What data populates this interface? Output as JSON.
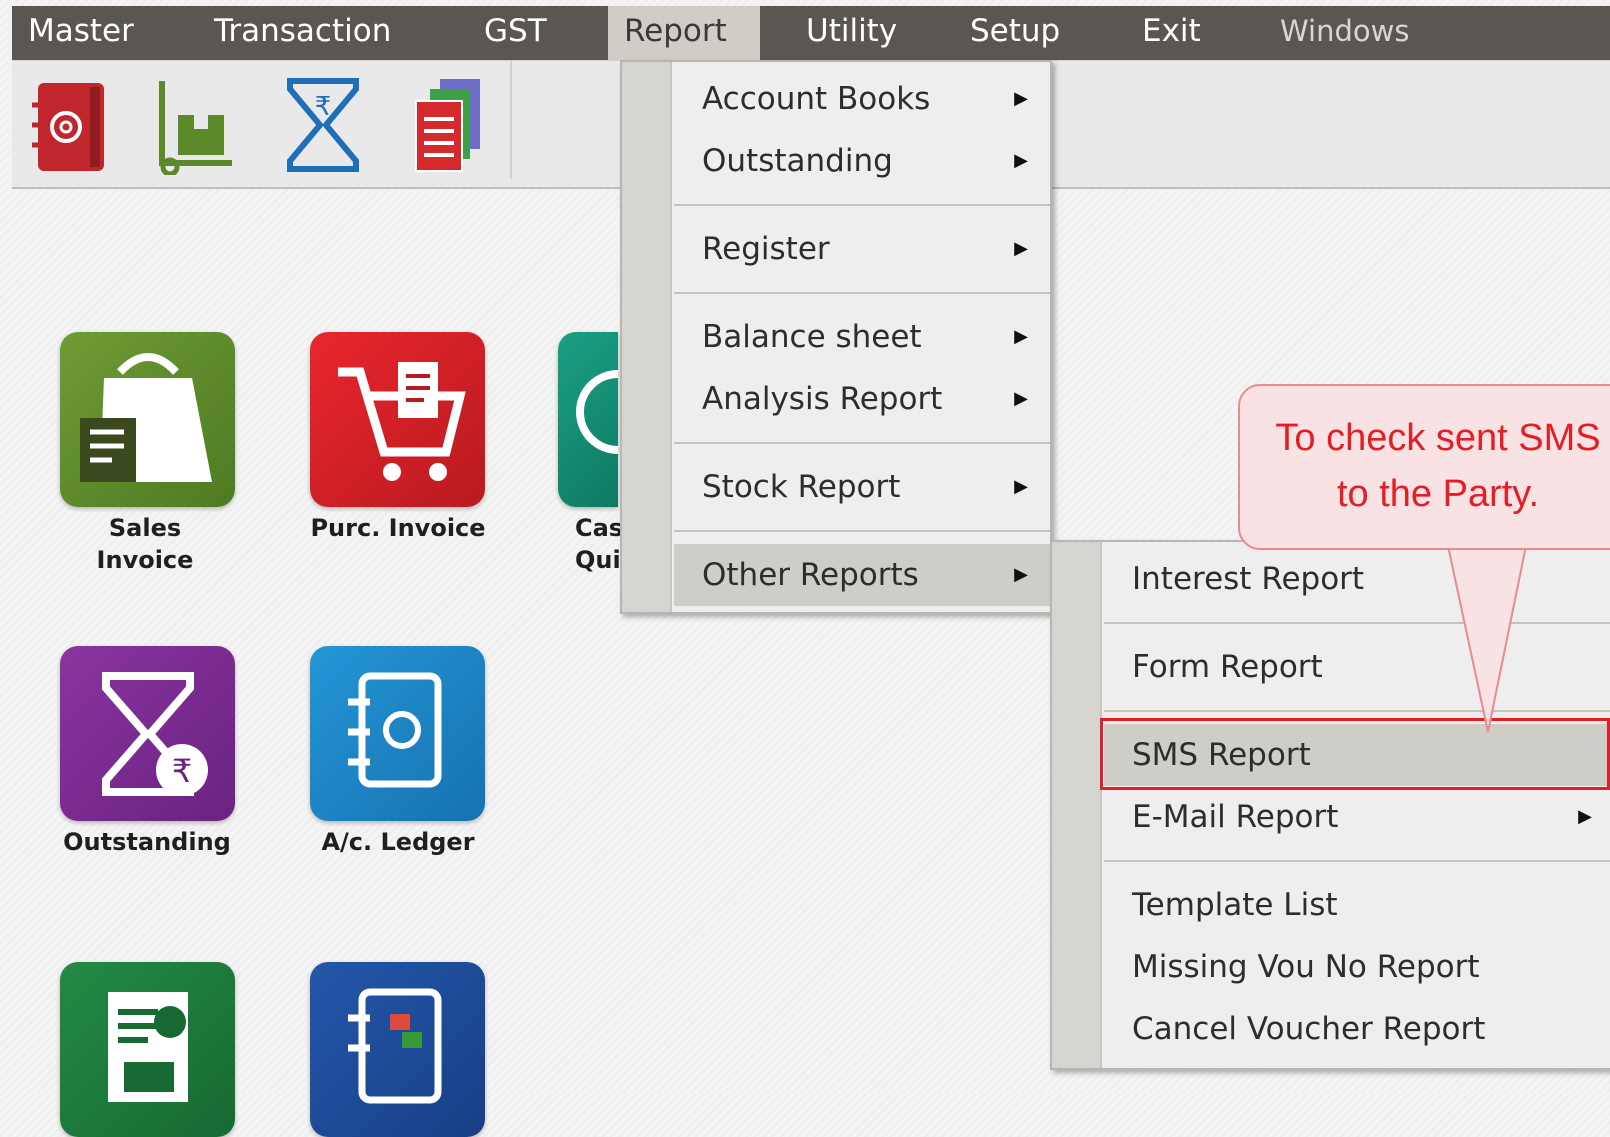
{
  "menubar": {
    "items": [
      {
        "label": "Master"
      },
      {
        "label": "Transaction"
      },
      {
        "label": "GST"
      },
      {
        "label": "Report"
      },
      {
        "label": "Utility"
      },
      {
        "label": "Setup"
      },
      {
        "label": "Exit"
      },
      {
        "label": "Windows"
      }
    ]
  },
  "toolbar": {
    "icons": [
      "address-book-icon",
      "trolley-box-icon",
      "rupee-hourglass-icon",
      "documents-stack-icon"
    ]
  },
  "tiles": [
    {
      "label_line1": "Sales",
      "label_line2": "Invoice",
      "icon": "shopping-bag-icon",
      "color": "#5e8a2e"
    },
    {
      "label_line1": "Purc. Invoice",
      "label_line2": "",
      "icon": "shopping-cart-icon",
      "color": "#d92027"
    },
    {
      "label_line1": "Cas",
      "label_line2": "Quic",
      "icon": "cash-icon",
      "color": "#128a6e"
    },
    {
      "label_line1": "Outstanding",
      "label_line2": "",
      "icon": "sigma-rupee-icon",
      "color": "#7a2d8e"
    },
    {
      "label_line1": "A/c. Ledger",
      "label_line2": "",
      "icon": "ledger-icon",
      "color": "#1f86c8"
    },
    {
      "label_line1": "",
      "label_line2": "",
      "icon": "report-chart-icon",
      "color": "#1d7a3c"
    },
    {
      "label_line1": "",
      "label_line2": "",
      "icon": "stock-book-icon",
      "color": "#1d4f9e"
    }
  ],
  "report_menu": {
    "items": [
      {
        "label": "Account Books",
        "arrow": "▶"
      },
      {
        "label": "Outstanding",
        "arrow": "▶"
      },
      {
        "label": "Register",
        "arrow": "▶"
      },
      {
        "label": "Balance sheet",
        "arrow": "▶"
      },
      {
        "label": "Analysis Report",
        "arrow": "▶"
      },
      {
        "label": "Stock Report",
        "arrow": "▶"
      },
      {
        "label": "Other Reports",
        "arrow": "▶"
      }
    ]
  },
  "other_reports_menu": {
    "items": [
      {
        "label": "Interest Report",
        "arrow": ""
      },
      {
        "label": "Form Report",
        "arrow": ""
      },
      {
        "label": "SMS Report",
        "arrow": ""
      },
      {
        "label": "E-Mail Report",
        "arrow": "▶"
      },
      {
        "label": "Template List",
        "arrow": ""
      },
      {
        "label": "Missing Vou No Report",
        "arrow": ""
      },
      {
        "label": "Cancel Voucher Report",
        "arrow": ""
      }
    ]
  },
  "callout": {
    "line1": "To check sent SMS",
    "line2": "to the Party."
  },
  "colors": {
    "menubar": "#5a5752",
    "highlight_box": "#e31e24",
    "callout_text": "#e31e24",
    "callout_bg": "#f8e2e3"
  }
}
